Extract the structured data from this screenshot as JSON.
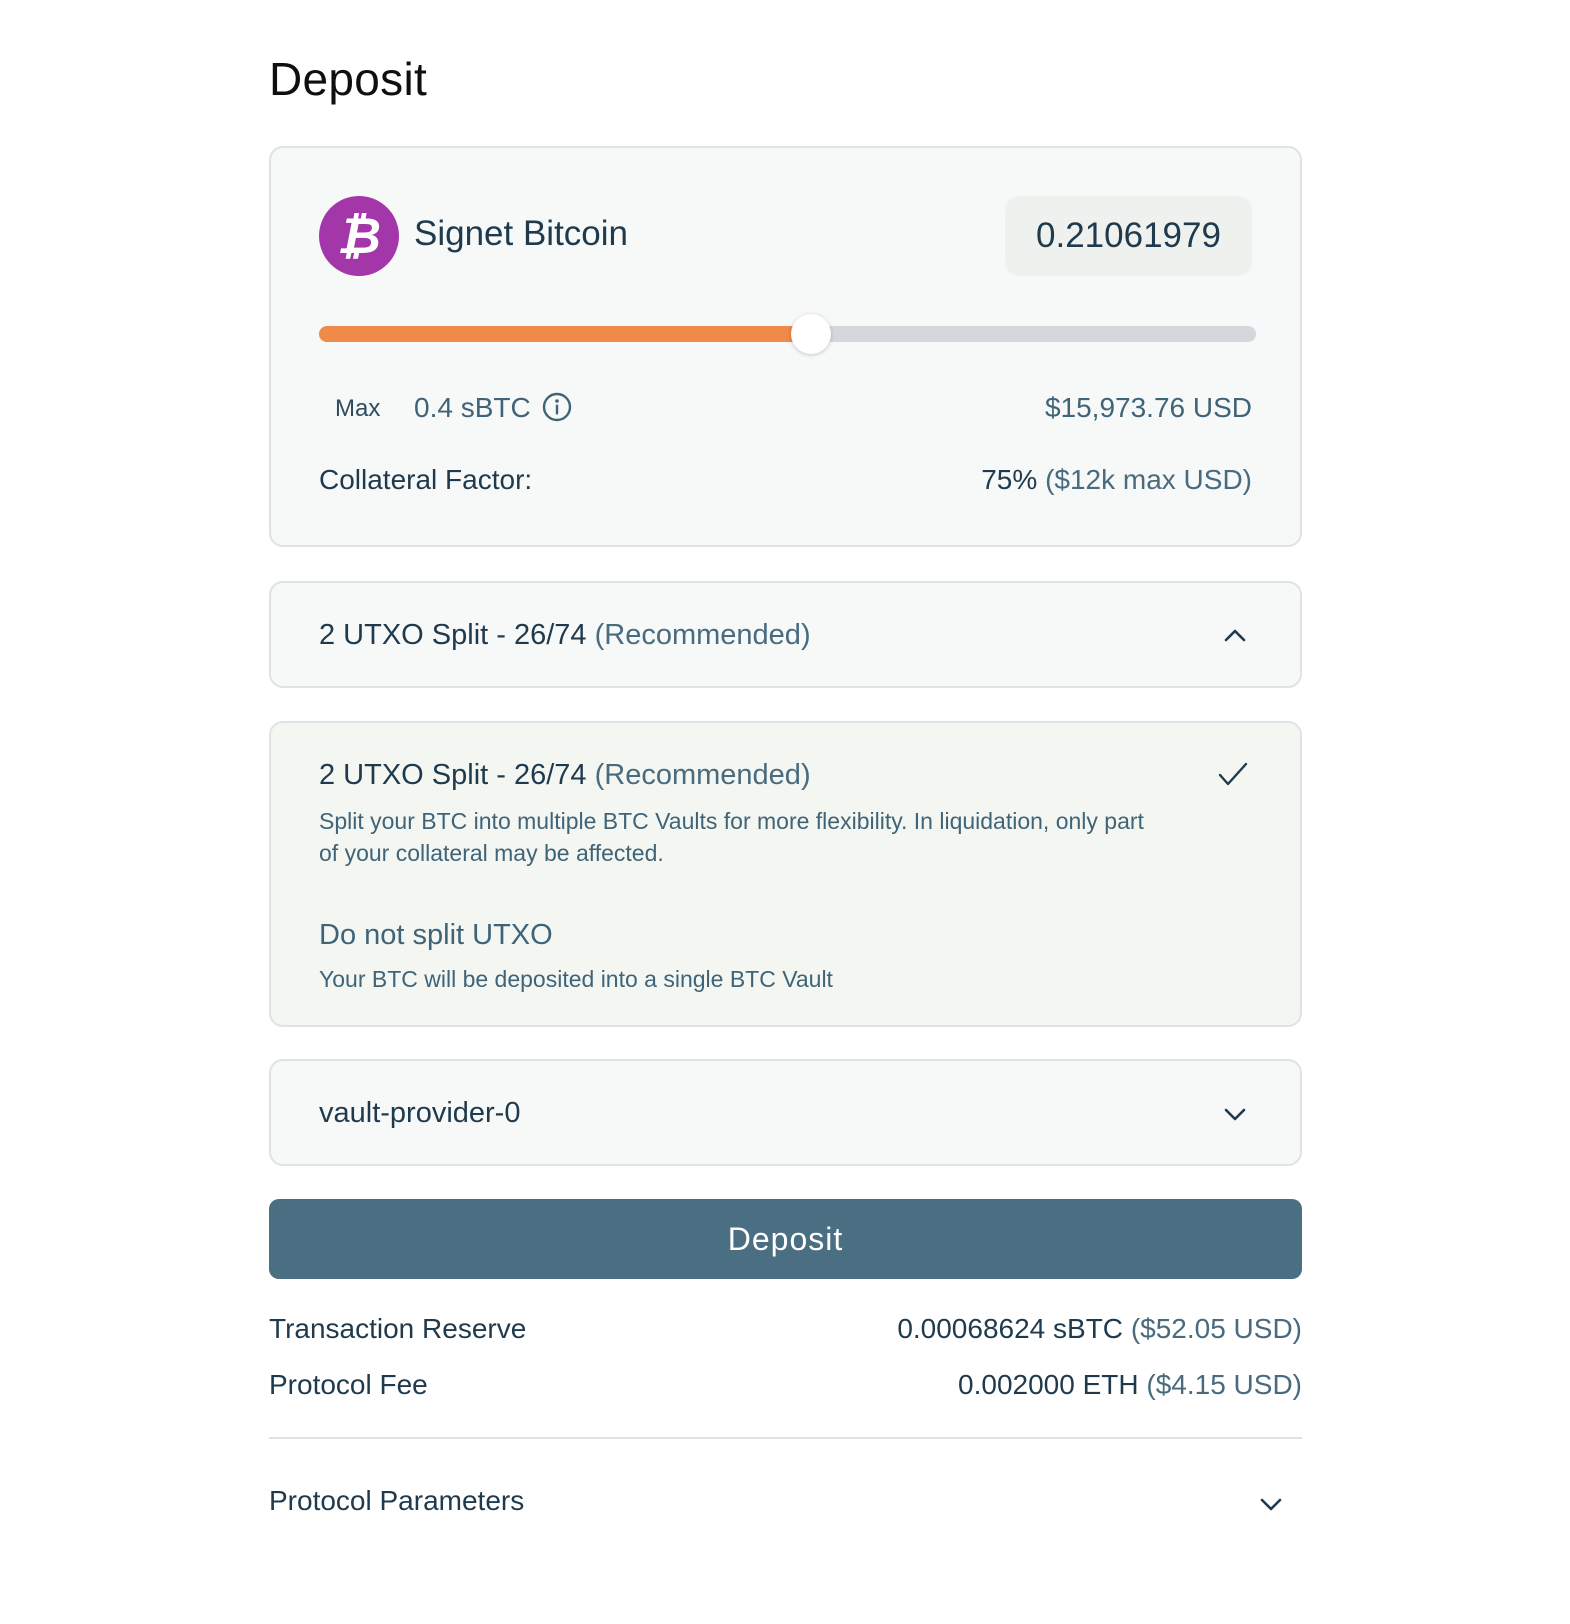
{
  "page": {
    "title": "Deposit"
  },
  "asset": {
    "icon": "bitcoin-icon",
    "coin_symbol": "₿",
    "name": "Signet Bitcoin",
    "amount": "0.21061979",
    "slider_fraction": 0.525,
    "max_label": "Max",
    "max_value": "0.4 sBTC",
    "usd_value": "$15,973.76 USD",
    "collateral_label": "Collateral Factor:",
    "collateral_value": "75%",
    "collateral_usd": "($12k max USD)"
  },
  "colors": {
    "coin": "#a336a8",
    "slider_fill": "#ef8a48",
    "slider_track": "#d5d7dc",
    "button": "#4a6e82"
  },
  "split_select": {
    "selected": "2 UTXO Split - 26/74",
    "selected_note": "(Recommended)",
    "icon": "chevron-up-icon"
  },
  "split_options": [
    {
      "title": "2 UTXO Split - 26/74",
      "note": "(Recommended)",
      "description": "Split your BTC into multiple BTC Vaults for more flexibility. In liquidation, only part of your collateral may be affected.",
      "selected": true,
      "icon": "check-icon"
    },
    {
      "title": "Do not split UTXO",
      "description": "Your BTC will be deposited into a single BTC Vault",
      "selected": false
    }
  ],
  "provider_select": {
    "selected": "vault-provider-0",
    "icon": "chevron-down-icon"
  },
  "deposit_button": "Deposit",
  "fees": {
    "reserve_label": "Transaction Reserve",
    "reserve_value": "0.00068624 sBTC",
    "reserve_usd": "($52.05 USD)",
    "fee_label": "Protocol Fee",
    "fee_value": "0.002000 ETH",
    "fee_usd": "($4.15 USD)"
  },
  "protocol_params": {
    "label": "Protocol Parameters",
    "icon": "chevron-down-icon"
  }
}
